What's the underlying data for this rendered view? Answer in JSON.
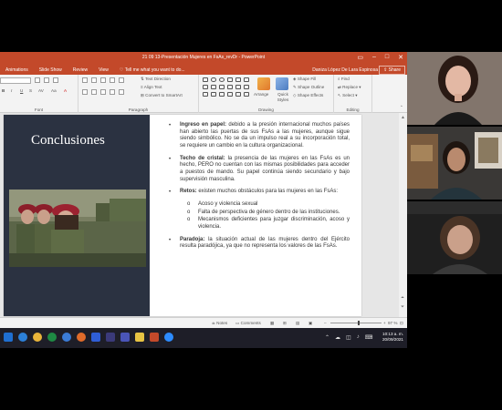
{
  "window": {
    "title": "21 09 13-Presentación Mujeres en FsAs_revDr - PowerPoint",
    "user": "Daniza López De Lara Espinosa",
    "share_label": "Share"
  },
  "ribbon_tabs": [
    "Animations",
    "Slide Show",
    "Review",
    "View"
  ],
  "tell_me": "Tell me what you want to do...",
  "groups": {
    "font": "Font",
    "paragraph": "Paragraph",
    "drawing": "Drawing",
    "editing": "Editing"
  },
  "paragraph_items": {
    "text_direction": "Text Direction",
    "align_text": "Align Text",
    "convert_smartart": "Convert to SmartArt"
  },
  "drawing_items": {
    "arrange": "Arrange",
    "quick_styles": "Quick Styles",
    "shape_fill": "Shape Fill",
    "shape_outline": "Shape Outline",
    "shape_effects": "Shape Effects"
  },
  "editing_items": {
    "find": "Find",
    "replace": "Replace",
    "select": "Select"
  },
  "slide": {
    "heading": "Conclusiones",
    "bullets": [
      {
        "bold": "Ingreso en papel:",
        "text": " debido a la presión internacional muchos países han abierto las puertas de sus FsAs a las mujeres, aunque sigue siendo simbólico. No se da un impulso real a su incorporación total, se requiere un cambio en la cultura organizacional."
      },
      {
        "bold": "Techo de cristal:",
        "text": " la presencia de las mujeres en las FsAs es un hecho, PERO no cuentan con las mismas posibilidades para acceder a puestos de mando. Su papel continúa siendo secundario y bajo supervisión masculina."
      },
      {
        "bold": "Retos:",
        "text": " existen muchos obstáculos para las mujeres en las FsAs:",
        "subitems": [
          "Acoso y violencia sexual",
          "Falta de perspectiva de género dentro de las instituciones.",
          "Mecanismos deficientes para juzgar discriminación, acoso y violencia."
        ]
      },
      {
        "bold": "Paradoja:",
        "text": " la situación actual de las mujeres dentro del Ejército resulta paradójica, ya que no representa los valores de las FsAs."
      }
    ]
  },
  "statusbar": {
    "notes": "Notes",
    "comments": "Comments",
    "zoom": "97 %",
    "zoom_level": 0.55
  },
  "taskbar": {
    "time": "10:13 a. m.",
    "date": "20/09/2021"
  },
  "colors": {
    "ppt_accent": "#c3492a",
    "slide_dark": "#2b3241",
    "taskbar": "#1e1e28"
  }
}
